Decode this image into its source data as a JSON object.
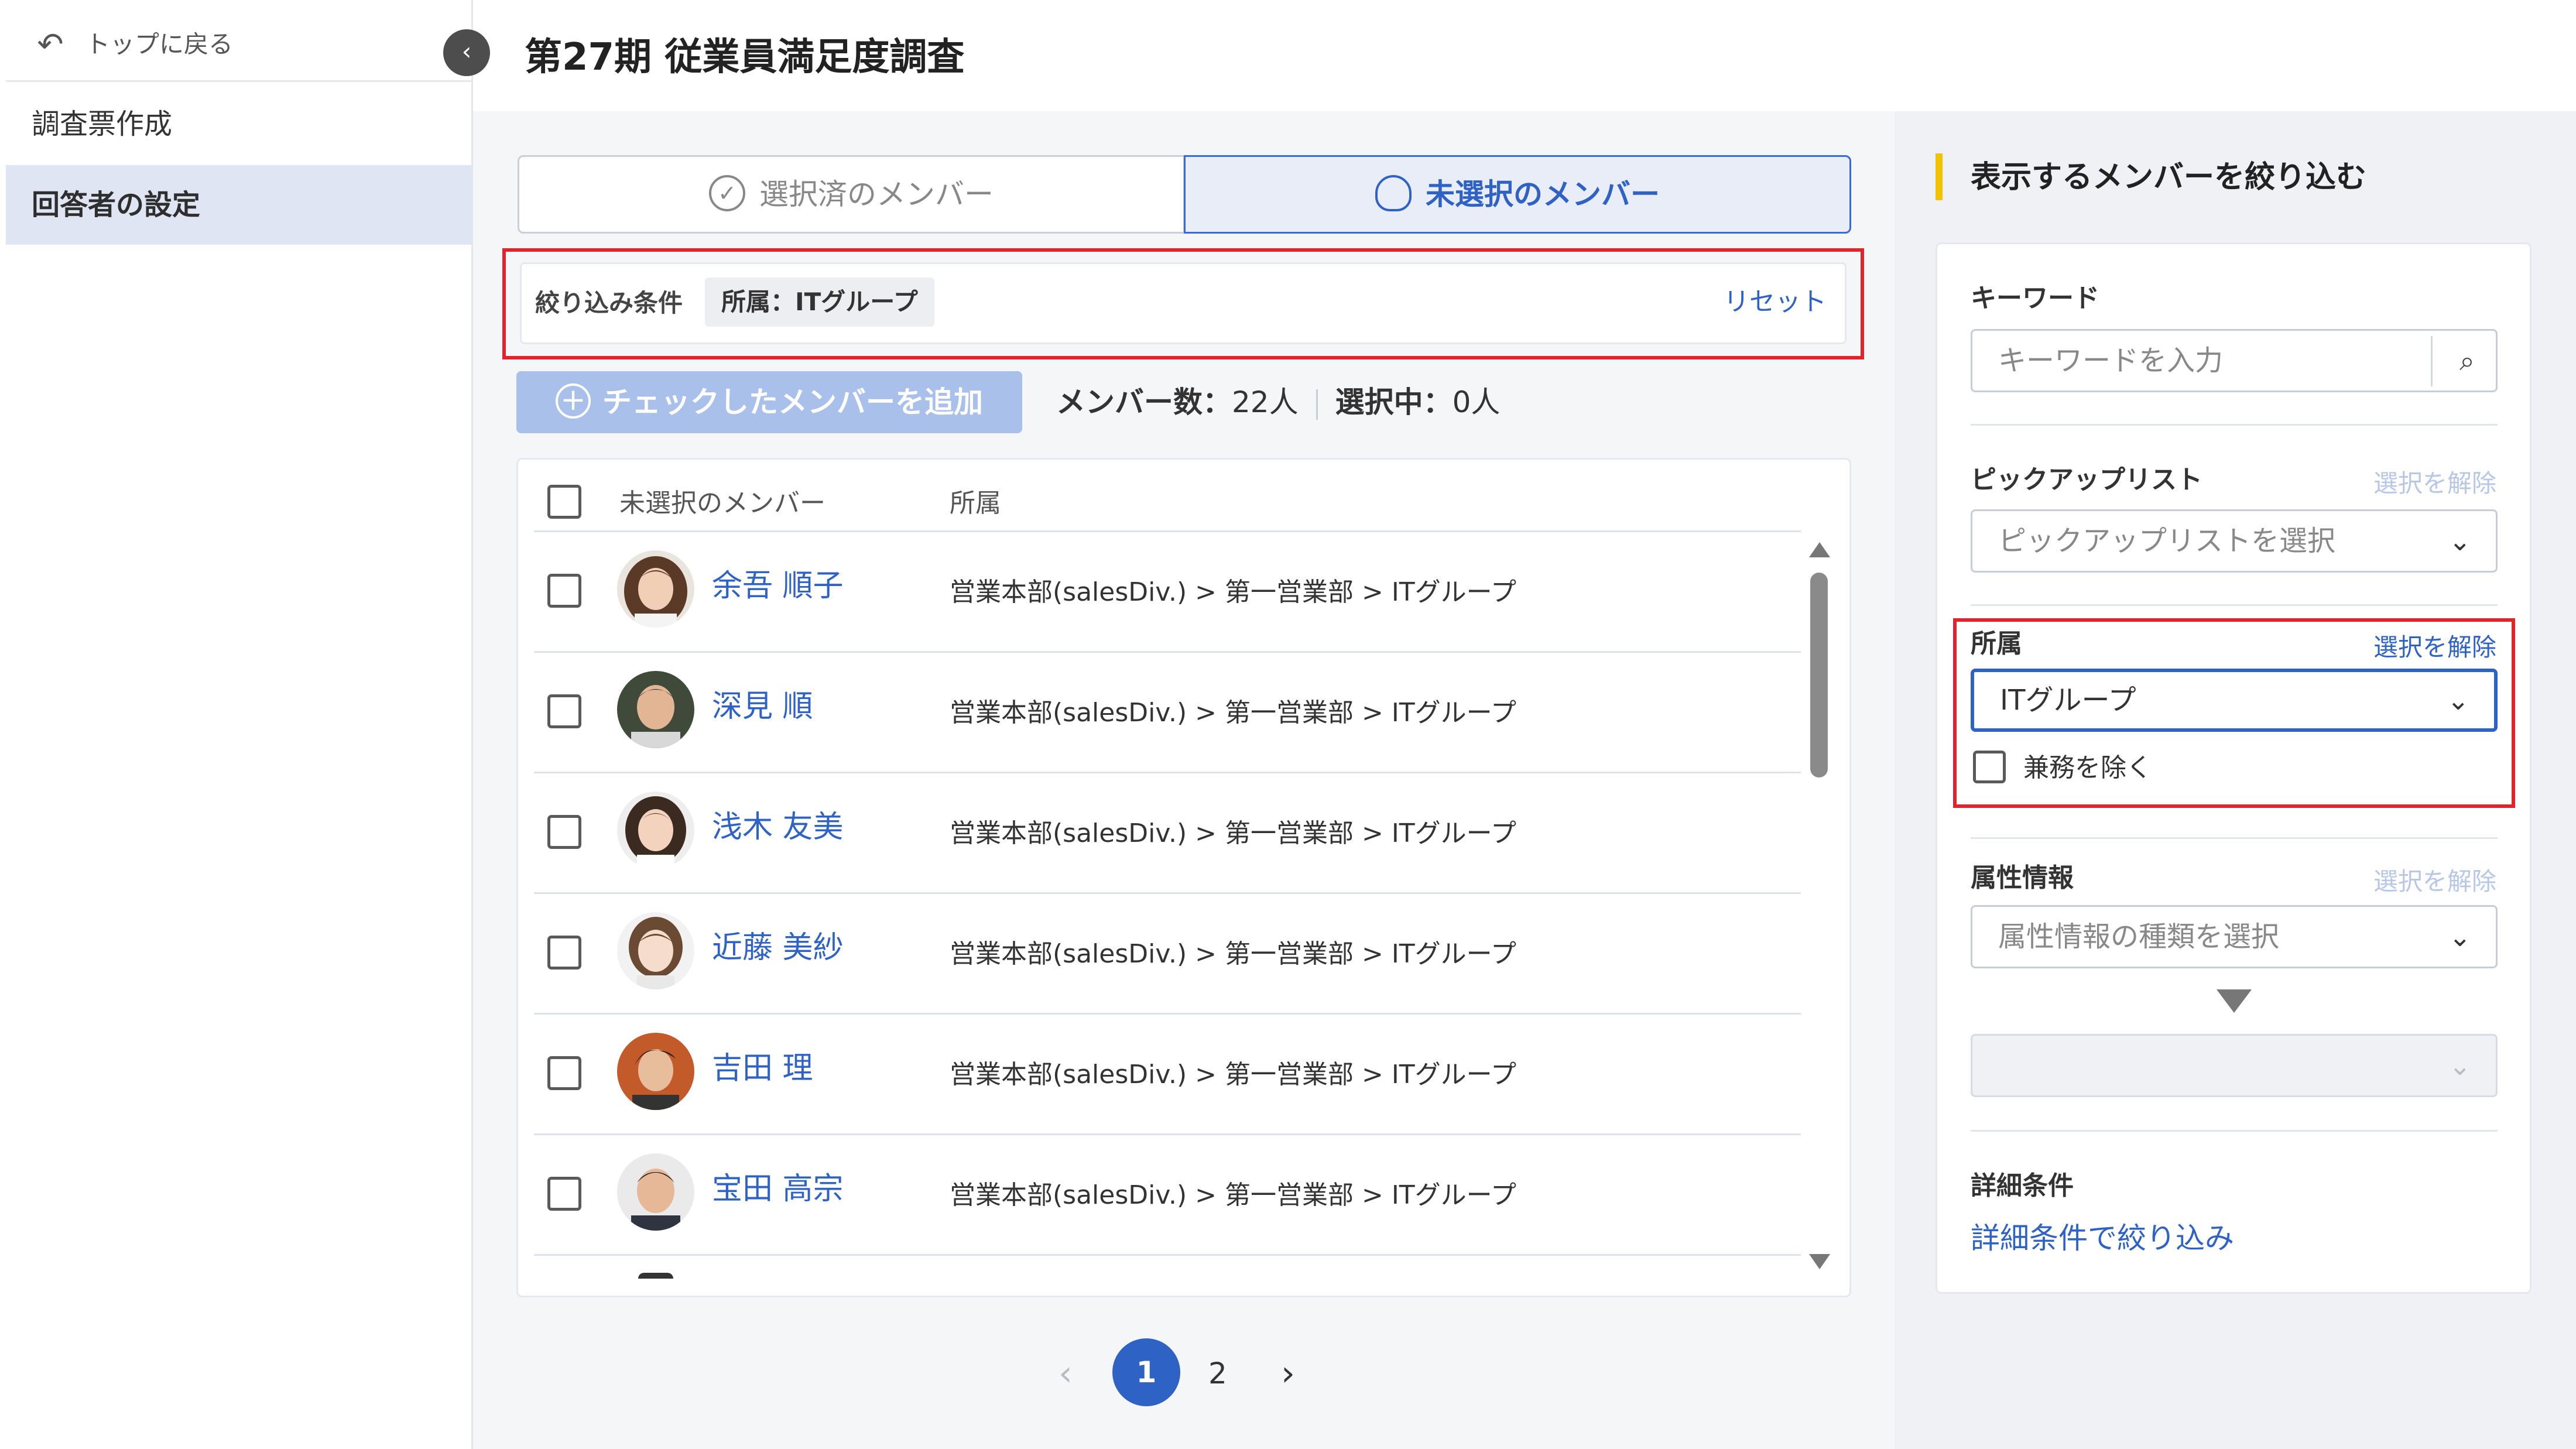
{
  "sidebar": {
    "back_label": "トップに戻る",
    "back_icon": "undo-arrow-icon",
    "collapse_icon": "chevron-left-icon",
    "items": [
      {
        "label": "調査票作成"
      },
      {
        "label": "回答者の設定",
        "active": true
      }
    ]
  },
  "header": {
    "title": "第27期 従業員満足度調査"
  },
  "tabs": [
    {
      "label": "選択済のメンバー",
      "icon": "check-circle-icon",
      "active": false
    },
    {
      "label": "未選択のメンバー",
      "icon": "users-icon",
      "active": true
    }
  ],
  "filter": {
    "label": "絞り込み条件",
    "chip": "所属：ITグループ",
    "reset": "リセット"
  },
  "actions": {
    "add_button": "チェックしたメンバーを追加",
    "member_count_label": "メンバー数：",
    "member_count_value": "22人",
    "selected_label": "選択中：",
    "selected_value": "0人"
  },
  "table": {
    "headers": [
      "未選択のメンバー",
      "所属"
    ],
    "rows": [
      {
        "name": "余吾 順子",
        "dept": "営業本部(salesDiv.) > 第一営業部 > ITグループ"
      },
      {
        "name": "深見 順",
        "dept": "営業本部(salesDiv.) > 第一営業部 > ITグループ"
      },
      {
        "name": "浅木 友美",
        "dept": "営業本部(salesDiv.) > 第一営業部 > ITグループ"
      },
      {
        "name": "近藤 美紗",
        "dept": "営業本部(salesDiv.) > 第一営業部 > ITグループ"
      },
      {
        "name": "吉田 理",
        "dept": "営業本部(salesDiv.) > 第一営業部 > ITグループ"
      },
      {
        "name": "宝田 高宗",
        "dept": "営業本部(salesDiv.) > 第一営業部 > ITグループ"
      }
    ]
  },
  "pagination": {
    "prev": "‹",
    "pages": [
      "1",
      "2"
    ],
    "current": "1",
    "next": "›"
  },
  "panel": {
    "title": "表示するメンバーを絞り込む",
    "keyword": {
      "label": "キーワード",
      "placeholder": "キーワードを入力"
    },
    "pickup": {
      "label": "ピックアップリスト",
      "clear": "選択を解除",
      "placeholder": "ピックアップリストを選択"
    },
    "dept": {
      "label": "所属",
      "clear": "選択を解除",
      "value": "ITグループ",
      "exclude_label": "兼務を除く"
    },
    "attr": {
      "label": "属性情報",
      "clear": "選択を解除",
      "placeholder": "属性情報の種類を選択"
    },
    "detail": {
      "label": "詳細条件",
      "link": "詳細条件で絞り込み"
    }
  },
  "colors": {
    "accent_blue": "#2e62c5",
    "highlight_red": "#e0242b",
    "title_accent_yellow": "#f2c200",
    "disabled_button": "#a9c0ea"
  }
}
